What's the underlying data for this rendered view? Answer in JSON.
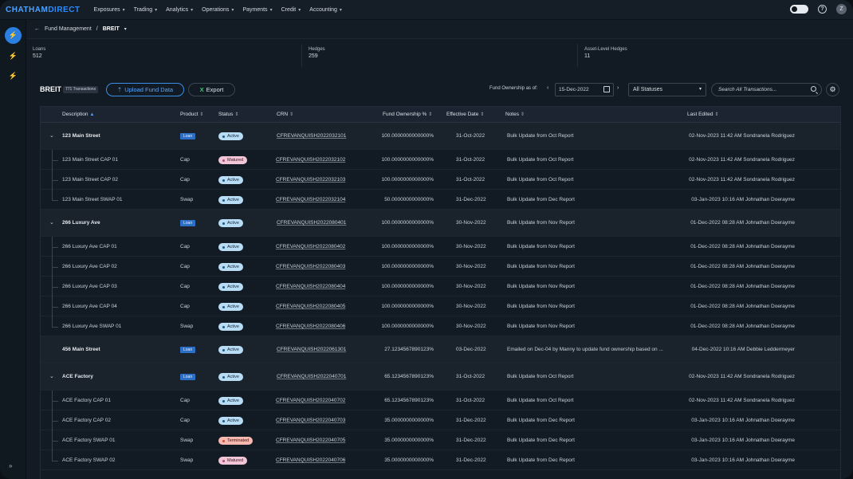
{
  "brand": {
    "part1": "CHATHAM",
    "part2": "DIRECT",
    "accent": "#2b8cff"
  },
  "nav": {
    "menu": [
      "Exposures",
      "Trading",
      "Analytics",
      "Operations",
      "Payments",
      "Credit",
      "Accounting"
    ],
    "help_icon": "question-circle-icon",
    "user_initial": "Z"
  },
  "breadcrumb": {
    "parent": "Fund Management",
    "separator": "/",
    "current": "BREIT"
  },
  "stats": [
    {
      "label": "Loans",
      "value": "512"
    },
    {
      "label": "Hedges",
      "value": "259"
    },
    {
      "label": "Asset-Level Hedges",
      "value": "11"
    }
  ],
  "toolbar": {
    "title": "BREIT",
    "count_badge": "771 Transactions",
    "upload_label": "Upload Fund Data",
    "export_label": "Export",
    "fund_ownership_label": "Fund Ownership as of:",
    "date_value": "15-Dec-2022",
    "status_value": "All Statuses",
    "search_placeholder": "Search All Transactions..."
  },
  "table": {
    "columns": [
      "Description",
      "Product",
      "Status",
      "CRN",
      "Fund Ownership %",
      "Effective Date",
      "Notes",
      "Last Edited"
    ],
    "rows": [
      {
        "kind": "parent",
        "caret": true,
        "description": "123 Main Street",
        "product": "Loan",
        "status": "Active",
        "crn": "CFREVANQUISH2022032101",
        "ownership": "100.0000000000000%",
        "effective": "31-Oct-2022",
        "notes": "Bulk Update from Oct Report",
        "edited": "02-Nov-2023 11:42 AM Sondranela Rodriguez"
      },
      {
        "kind": "child",
        "description": "123 Main Street CAP 01",
        "product": "Cap",
        "status": "Matured",
        "crn": "CFREVANQUISH2022032102",
        "ownership": "100.0000000000000%",
        "effective": "31-Oct-2022",
        "notes": "Bulk Update from Oct Report",
        "edited": "02-Nov-2023 11:42 AM Sondranela Rodriguez"
      },
      {
        "kind": "child",
        "description": "123 Main Street CAP 02",
        "product": "Cap",
        "status": "Active",
        "crn": "CFREVANQUISH2022032103",
        "ownership": "100.0000000000000%",
        "effective": "31-Oct-2022",
        "notes": "Bulk Update from Oct Report",
        "edited": "02-Nov-2023 11:42 AM Sondranela Rodriguez"
      },
      {
        "kind": "child",
        "last": true,
        "description": "123 Main Street SWAP 01",
        "product": "Swap",
        "status": "Active",
        "crn": "CFREVANQUISH2022032104",
        "ownership": "50.0000000000000%",
        "effective": "31-Dec-2022",
        "notes": "Bulk Update from Dec Report",
        "edited": "03-Jan-2023 10:16 AM Johnathan Doerayme"
      },
      {
        "kind": "parent",
        "caret": true,
        "description": "266 Luxury Ave",
        "product": "Loan",
        "status": "Active",
        "crn": "CFREVANQUISH2022080401",
        "ownership": "100.0000000000000%",
        "effective": "30-Nov-2022",
        "notes": "Bulk Update from Nov Report",
        "edited": "01-Dec-2022 08:28 AM Johnathan Doerayme"
      },
      {
        "kind": "child",
        "description": "266 Luxury Ave CAP 01",
        "product": "Cap",
        "status": "Active",
        "crn": "CFREVANQUISH2022080402",
        "ownership": "100.0000000000000%",
        "effective": "30-Nov-2022",
        "notes": "Bulk Update from Nov Report",
        "edited": "01-Dec-2022 08:28 AM Johnathan Doerayme"
      },
      {
        "kind": "child",
        "description": "266 Luxury Ave CAP 02",
        "product": "Cap",
        "status": "Active",
        "crn": "CFREVANQUISH2022080403",
        "ownership": "100.0000000000000%",
        "effective": "30-Nov-2022",
        "notes": "Bulk Update from Nov Report",
        "edited": "01-Dec-2022 08:28 AM Johnathan Doerayme"
      },
      {
        "kind": "child",
        "description": "266 Luxury Ave CAP 03",
        "product": "Cap",
        "status": "Active",
        "crn": "CFREVANQUISH2022080404",
        "ownership": "100.0000000000000%",
        "effective": "30-Nov-2022",
        "notes": "Bulk Update from Nov Report",
        "edited": "01-Dec-2022 08:28 AM Johnathan Doerayme"
      },
      {
        "kind": "child",
        "description": "266 Luxury Ave CAP 04",
        "product": "Cap",
        "status": "Active",
        "crn": "CFREVANQUISH2022080405",
        "ownership": "100.0000000000000%",
        "effective": "30-Nov-2022",
        "notes": "Bulk Update from Nov Report",
        "edited": "01-Dec-2022 08:28 AM Johnathan Doerayme"
      },
      {
        "kind": "child",
        "last": true,
        "description": "266 Luxury Ave SWAP 01",
        "product": "Swap",
        "status": "Active",
        "crn": "CFREVANQUISH2022080406",
        "ownership": "100.0000000000000%",
        "effective": "30-Nov-2022",
        "notes": "Bulk Update from Nov Report",
        "edited": "01-Dec-2022 08:28 AM Johnathan Doerayme"
      },
      {
        "kind": "parent",
        "caret": false,
        "description": "456 Main Street",
        "product": "Loan",
        "status": "Active",
        "crn": "CFREVANQUISH2022061301",
        "ownership": "27.1234567890123%",
        "effective": "03-Dec-2022",
        "notes": "Emailed on Dec-04 by Manny to update fund ownership based on ...",
        "edited": "04-Dec-2022 10:16 AM Debbie Leddermeyer"
      },
      {
        "kind": "parent",
        "caret": true,
        "description": "ACE Factory",
        "product": "Loan",
        "status": "Active",
        "crn": "CFREVANQUISH2022040701",
        "ownership": "65.1234567890123%",
        "effective": "31-Oct-2022",
        "notes": "Bulk Update from Oct Report",
        "edited": "02-Nov-2023 11:42 AM Sondranela Rodriguez"
      },
      {
        "kind": "child",
        "description": "ACE Factory CAP 01",
        "product": "Cap",
        "status": "Active",
        "crn": "CFREVANQUISH2022040702",
        "ownership": "65.1234567890123%",
        "effective": "31-Oct-2022",
        "notes": "Bulk Update from Oct Report",
        "edited": "02-Nov-2023 11:42 AM Sondranela Rodriguez"
      },
      {
        "kind": "child",
        "description": "ACE Factory CAP 02",
        "product": "Cap",
        "status": "Active",
        "crn": "CFREVANQUISH2022040703",
        "ownership": "35.0000000000000%",
        "effective": "31-Dec-2022",
        "notes": "Bulk Update from Dec Report",
        "edited": "03-Jan-2023 10:16 AM Johnathan Doerayme"
      },
      {
        "kind": "child",
        "description": "ACE Factory SWAP 01",
        "product": "Swap",
        "status": "Terminated",
        "crn": "CFREVANQUISH2022040705",
        "ownership": "35.0000000000000%",
        "effective": "31-Dec-2022",
        "notes": "Bulk Update from Dec Report",
        "edited": "03-Jan-2023 10:16 AM Johnathan Doerayme"
      },
      {
        "kind": "child",
        "last": true,
        "description": "ACE Factory SWAP 02",
        "product": "Swap",
        "status": "Matured",
        "crn": "CFREVANQUISH2022040706",
        "ownership": "35.0000000000000%",
        "effective": "31-Dec-2022",
        "notes": "Bulk Update from Dec Report",
        "edited": "03-Jan-2023 10:16 AM Johnathan Doerayme"
      }
    ]
  }
}
